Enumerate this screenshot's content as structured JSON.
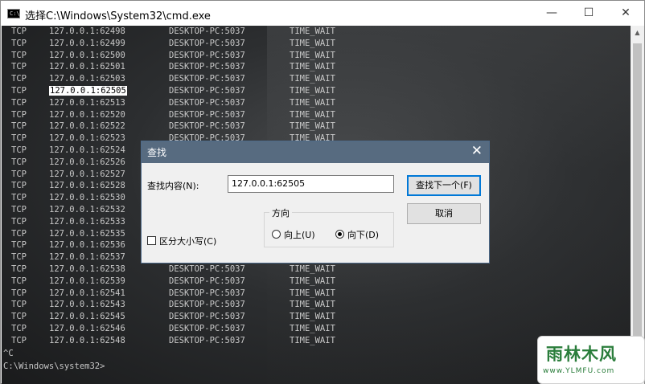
{
  "window": {
    "title": "选择C:\\Windows\\System32\\cmd.exe",
    "icon_text": "C:\\",
    "controls": [
      "—",
      "☐",
      "✕"
    ]
  },
  "console": {
    "rows": [
      [
        "TCP",
        "127.0.0.1:62498",
        "DESKTOP-PC:5037",
        "TIME_WAIT"
      ],
      [
        "TCP",
        "127.0.0.1:62499",
        "DESKTOP-PC:5037",
        "TIME_WAIT"
      ],
      [
        "TCP",
        "127.0.0.1:62500",
        "DESKTOP-PC:5037",
        "TIME_WAIT"
      ],
      [
        "TCP",
        "127.0.0.1:62501",
        "DESKTOP-PC:5037",
        "TIME_WAIT"
      ],
      [
        "TCP",
        "127.0.0.1:62503",
        "DESKTOP-PC:5037",
        "TIME_WAIT"
      ],
      [
        "TCP",
        "127.0.0.1:62505",
        "DESKTOP-PC:5037",
        "TIME_WAIT"
      ],
      [
        "TCP",
        "127.0.0.1:62513",
        "DESKTOP-PC:5037",
        "TIME_WAIT"
      ],
      [
        "TCP",
        "127.0.0.1:62520",
        "DESKTOP-PC:5037",
        "TIME_WAIT"
      ],
      [
        "TCP",
        "127.0.0.1:62522",
        "DESKTOP-PC:5037",
        "TIME_WAIT"
      ],
      [
        "TCP",
        "127.0.0.1:62523",
        "DESKTOP-PC:5037",
        "TIME_WAIT"
      ],
      [
        "TCP",
        "127.0.0.1:62524",
        "",
        ""
      ],
      [
        "TCP",
        "127.0.0.1:62526",
        "",
        ""
      ],
      [
        "TCP",
        "127.0.0.1:62527",
        "",
        ""
      ],
      [
        "TCP",
        "127.0.0.1:62528",
        "",
        ""
      ],
      [
        "TCP",
        "127.0.0.1:62530",
        "",
        ""
      ],
      [
        "TCP",
        "127.0.0.1:62532",
        "",
        ""
      ],
      [
        "TCP",
        "127.0.0.1:62533",
        "",
        ""
      ],
      [
        "TCP",
        "127.0.0.1:62535",
        "",
        ""
      ],
      [
        "TCP",
        "127.0.0.1:62536",
        "",
        ""
      ],
      [
        "TCP",
        "127.0.0.1:62537",
        "",
        ""
      ],
      [
        "TCP",
        "127.0.0.1:62538",
        "DESKTOP-PC:5037",
        "TIME_WAIT"
      ],
      [
        "TCP",
        "127.0.0.1:62539",
        "DESKTOP-PC:5037",
        "TIME_WAIT"
      ],
      [
        "TCP",
        "127.0.0.1:62541",
        "DESKTOP-PC:5037",
        "TIME_WAIT"
      ],
      [
        "TCP",
        "127.0.0.1:62543",
        "DESKTOP-PC:5037",
        "TIME_WAIT"
      ],
      [
        "TCP",
        "127.0.0.1:62545",
        "DESKTOP-PC:5037",
        "TIME_WAIT"
      ],
      [
        "TCP",
        "127.0.0.1:62546",
        "DESKTOP-PC:5037",
        "TIME_WAIT"
      ],
      [
        "TCP",
        "127.0.0.1:62548",
        "DESKTOP-PC:5037",
        "TIME_WAIT"
      ]
    ],
    "selected_text": "127.0.0.1:62505",
    "tail_line_1": "^C",
    "tail_line_2": "C:\\Windows\\system32>"
  },
  "find_dialog": {
    "title": "查找",
    "close_glyph": "✕",
    "find_label": "查找内容(N):",
    "find_value": "127.0.0.1:62505",
    "find_next_label": "查找下一个(F)",
    "cancel_label": "取消",
    "direction_legend": "方向",
    "up_label": "向上(U)",
    "down_label": "向下(D)",
    "direction_selected": "down",
    "match_case_label": "区分大小写(C)",
    "match_case_checked": false,
    "accent_color": "#0078d7",
    "title_color": "#576b80"
  },
  "watermark": {
    "main": "雨林木风",
    "url": "www.YLMFU.com"
  }
}
